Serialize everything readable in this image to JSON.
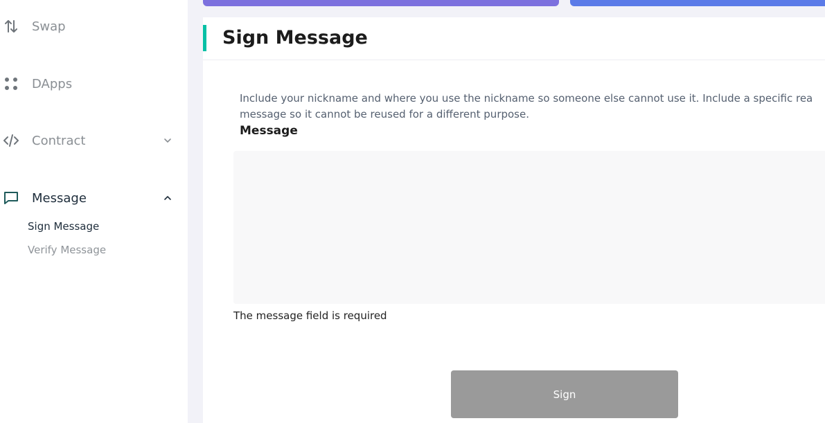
{
  "sidebar": {
    "items": [
      {
        "label": "Swap",
        "icon": "swap-icon"
      },
      {
        "label": "DApps",
        "icon": "dapps-icon"
      },
      {
        "label": "Contract",
        "icon": "code-icon",
        "expanded": false
      },
      {
        "label": "Message",
        "icon": "message-icon",
        "expanded": true,
        "children": [
          {
            "label": "Sign Message",
            "active": true
          },
          {
            "label": "Verify Message",
            "active": false
          }
        ]
      }
    ]
  },
  "panel": {
    "title": "Sign Message",
    "instructions_line1": "Include your nickname and where you use the nickname so someone else cannot use it. Include a specific rea",
    "instructions_line2": "message so it cannot be reused for a different purpose.",
    "message_label": "Message",
    "message_value": "",
    "error": "The message field is required",
    "sign_button": "Sign"
  },
  "colors": {
    "accent": "#05c0a5",
    "top_button_left": "#7c70de",
    "top_button_right": "#5b7be8",
    "disabled_button": "#9a9a9a",
    "input_bg": "#f8f8f9"
  }
}
